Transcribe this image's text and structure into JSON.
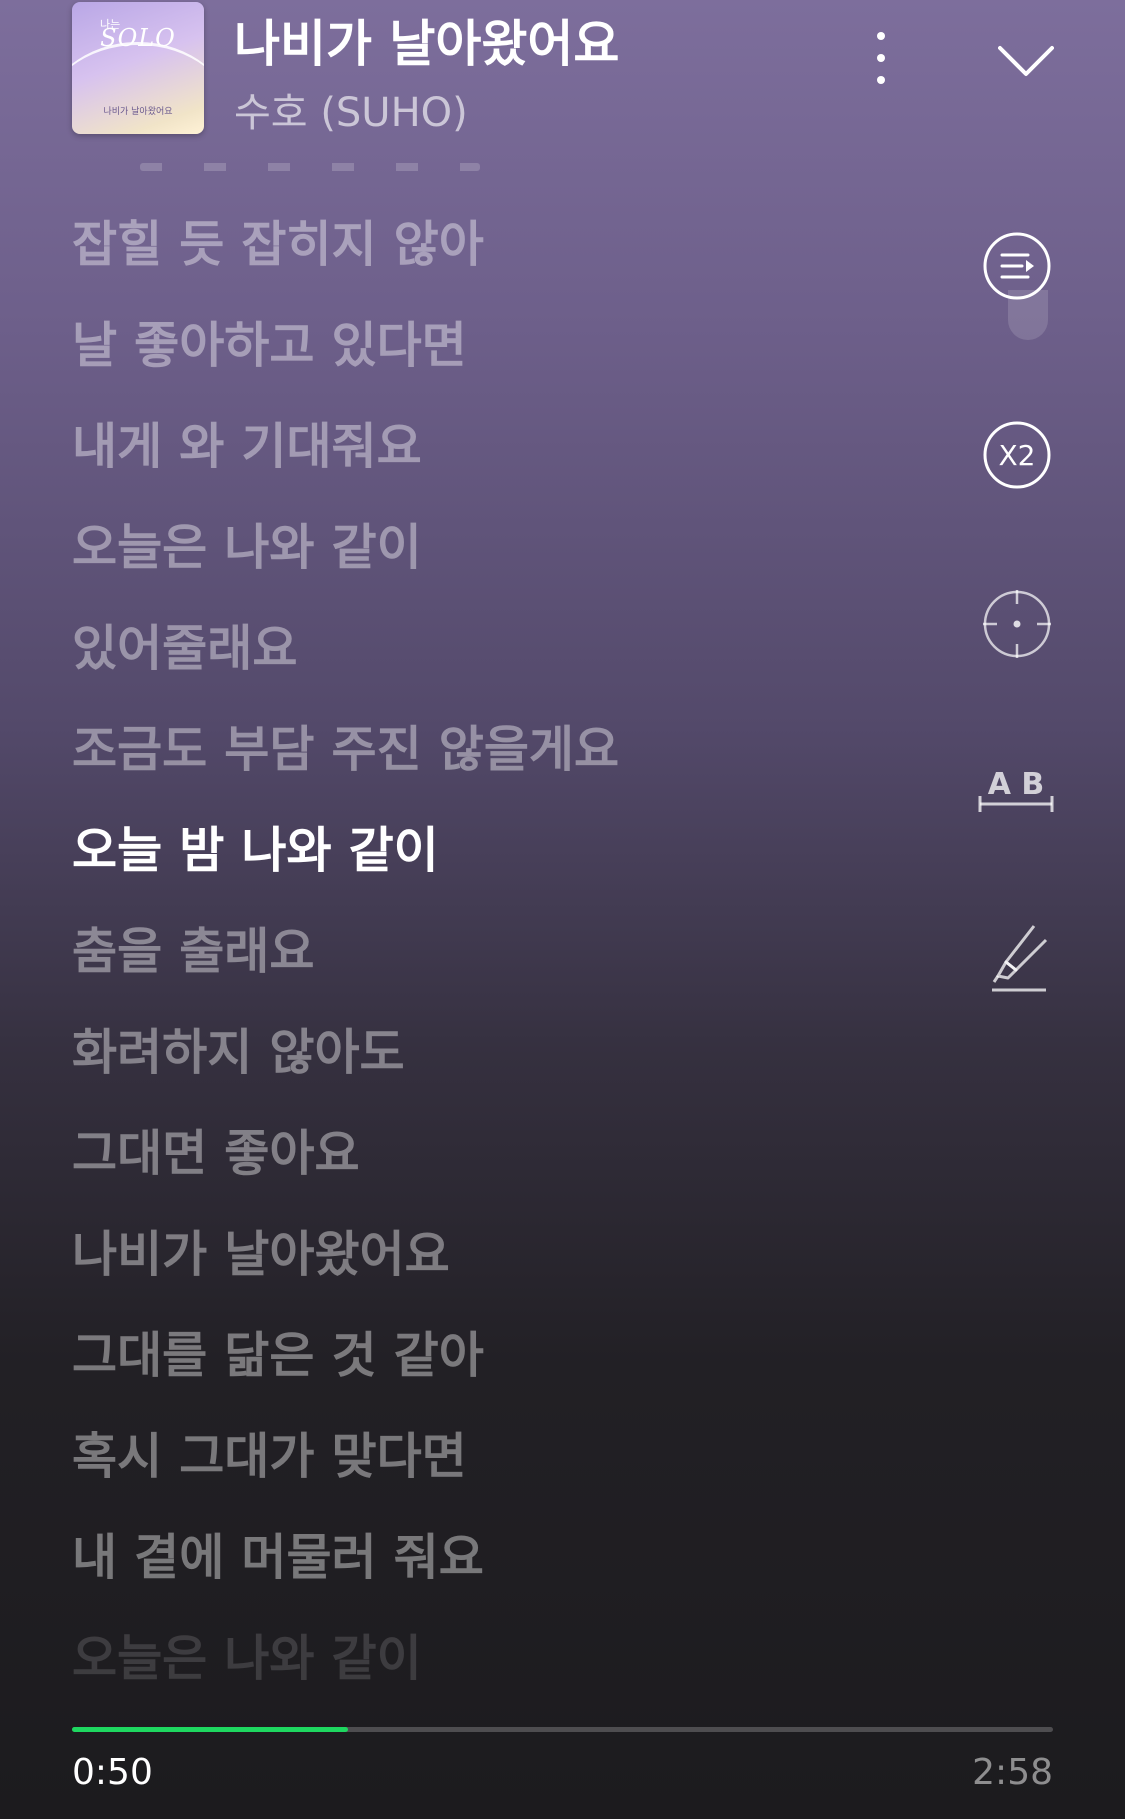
{
  "header": {
    "song_title": "나비가 날아왔어요",
    "artist": "수호 (SUHO)",
    "album_art": {
      "logo_top": "나는",
      "logo_main": "SOLO",
      "subtitle": "나비가 날아왔어요"
    },
    "more_icon": "more-vertical-icon",
    "collapse_icon": "chevron-down-icon"
  },
  "lyrics": {
    "lines": [
      "잡힐 듯 잡히지 않아",
      "날 좋아하고 있다면",
      "내게 와 기대줘요",
      "오늘은 나와 같이",
      "있어줄래요",
      "조금도 부담 주진 않을게요",
      "오늘 밤 나와 같이",
      "춤을 출래요",
      "화려하지 않아도",
      "그대면 좋아요",
      "나비가 날아왔어요",
      "그대를 닮은 것 같아",
      "혹시 그대가 맞다면",
      "내 곁에 머물러 줘요",
      "오늘은 나와 같이"
    ],
    "active_index": 6
  },
  "tools": {
    "queue_icon": "queue-play-icon",
    "speed_label": "X2",
    "focus_icon": "crosshair-icon",
    "ab_label": "A B",
    "highlight_icon": "highlighter-icon"
  },
  "playback": {
    "current_time": "0:50",
    "total_time": "2:58",
    "progress": 0.281,
    "accent_color": "#1ed760"
  }
}
